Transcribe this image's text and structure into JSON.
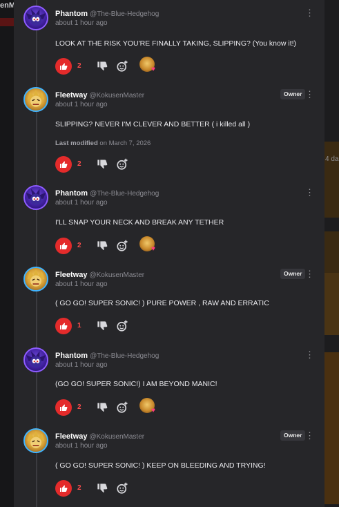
{
  "background": {
    "logo_fragment": "enM",
    "side_text": "4 da"
  },
  "comments": [
    {
      "author": "Phantom",
      "handle": "@The-Blue-Hedgehog",
      "time": "about 1 hour ago",
      "text": "LOOK AT THE RISK YOU'RE FINALLY TAKING, SLIPPING? (You know it!)",
      "likes": "2",
      "owner": false,
      "modified": null,
      "has_reaction": true
    },
    {
      "author": "Fleetway",
      "handle": "@KokusenMaster",
      "time": "about 1 hour ago",
      "text": "SLIPPING? NEVER I'M CLEVER AND BETTER ( i killed all )",
      "likes": "2",
      "owner": true,
      "badge": "Owner",
      "modified_label": "Last modified",
      "modified_on": "on March 7, 2026",
      "has_reaction": false
    },
    {
      "author": "Phantom",
      "handle": "@The-Blue-Hedgehog",
      "time": "about 1 hour ago",
      "text": "I'LL SNAP YOUR NECK AND BREAK ANY TETHER",
      "likes": "2",
      "owner": false,
      "has_reaction": true
    },
    {
      "author": "Fleetway",
      "handle": "@KokusenMaster",
      "time": "about 1 hour ago",
      "text": "( GO GO! SUPER SONIC! ) PURE POWER , RAW AND ERRATIC",
      "likes": "1",
      "owner": true,
      "badge": "Owner",
      "has_reaction": false
    },
    {
      "author": "Phantom",
      "handle": "@The-Blue-Hedgehog",
      "time": "about 1 hour ago",
      "text": "(GO GO! SUPER SONIC!) I AM BEYOND MANIC!",
      "likes": "2",
      "owner": false,
      "has_reaction": true
    },
    {
      "author": "Fleetway",
      "handle": "@KokusenMaster",
      "time": "about 1 hour ago",
      "text": "( GO GO! SUPER SONIC! ) KEEP ON BLEEDING AND TRYING!",
      "likes": "2",
      "owner": true,
      "badge": "Owner",
      "has_reaction": false
    }
  ],
  "colors": {
    "like": "#e42b2b",
    "like_count": "#ff4d4d",
    "phantom_ring": "#8e5cff",
    "fleetway_ring": "#41b4ff"
  },
  "icons": {
    "like": "thumbs-up-icon",
    "dislike": "thumbs-down-icon",
    "react": "add-reaction-icon",
    "menu": "kebab-menu-icon"
  }
}
